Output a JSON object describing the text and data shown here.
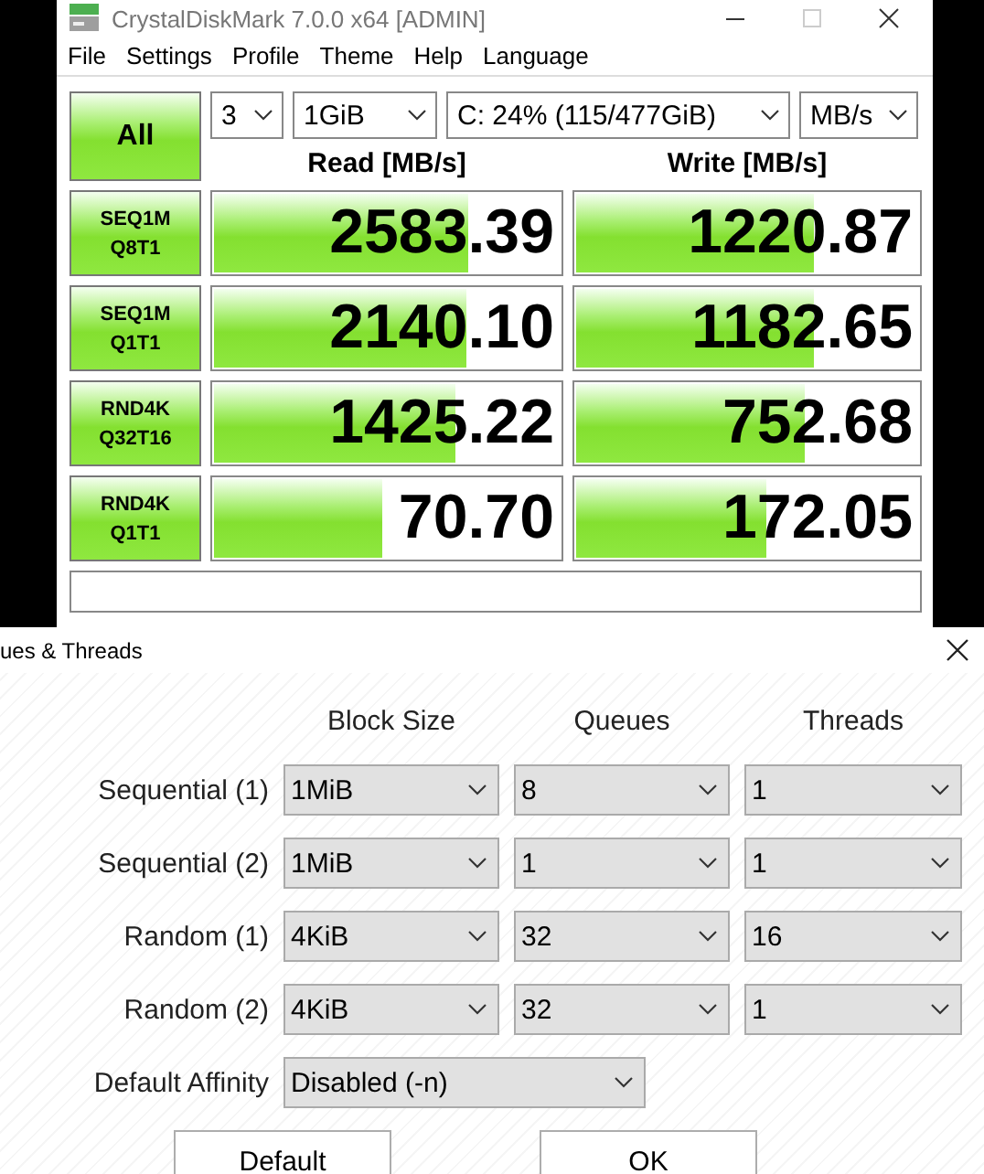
{
  "main_window": {
    "title": "CrystalDiskMark 7.0.0 x64 [ADMIN]",
    "menu": [
      "File",
      "Settings",
      "Profile",
      "Theme",
      "Help",
      "Language"
    ],
    "all_button": "All",
    "count": "3",
    "size": "1GiB",
    "drive": "C: 24% (115/477GiB)",
    "unit": "MB/s",
    "headers": [
      "Read [MB/s]",
      "Write [MB/s]"
    ],
    "tests": [
      {
        "line1": "SEQ1M",
        "line2": "Q8T1",
        "read": {
          "value": "2583.39",
          "level": 0.73
        },
        "write": {
          "value": "1220.87",
          "level": 0.69
        }
      },
      {
        "line1": "SEQ1M",
        "line2": "Q1T1",
        "read": {
          "value": "2140.10",
          "level": 0.72
        },
        "write": {
          "value": "1182.65",
          "level": 0.69
        }
      },
      {
        "line1": "RND4K",
        "line2": "Q32T16",
        "read": {
          "value": "1425.22",
          "level": 0.69
        },
        "write": {
          "value": "752.68",
          "level": 0.66
        }
      },
      {
        "line1": "RND4K",
        "line2": "Q1T1",
        "read": {
          "value": "70.70",
          "level": 0.48
        },
        "write": {
          "value": "172.05",
          "level": 0.55
        }
      }
    ]
  },
  "dialog": {
    "title": "ues & Threads",
    "columns": [
      "Block Size",
      "Queues",
      "Threads"
    ],
    "rows": [
      {
        "label": "Sequential (1)",
        "block_size": "1MiB",
        "queues": "8",
        "threads": "1"
      },
      {
        "label": "Sequential (2)",
        "block_size": "1MiB",
        "queues": "1",
        "threads": "1"
      },
      {
        "label": "Random (1)",
        "block_size": "4KiB",
        "queues": "32",
        "threads": "16"
      },
      {
        "label": "Random (2)",
        "block_size": "4KiB",
        "queues": "32",
        "threads": "1"
      }
    ],
    "affinity": {
      "label": "Default Affinity",
      "value": "Disabled (-n)"
    },
    "buttons": [
      "Default",
      "OK"
    ]
  }
}
